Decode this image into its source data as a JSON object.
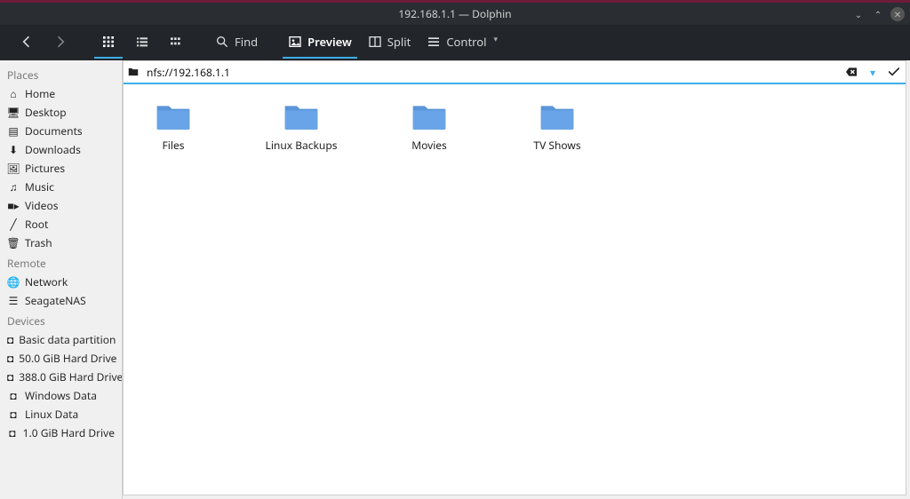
{
  "titlebar": {
    "title": "192.168.1.1 — Dolphin"
  },
  "toolbar": {
    "find": "Find",
    "preview": "Preview",
    "split": "Split",
    "control": "Control"
  },
  "addressbar": {
    "value": "nfs://192.168.1.1"
  },
  "sidebar": {
    "sections": [
      {
        "title": "Places",
        "items": [
          {
            "icon": "home",
            "label": "Home"
          },
          {
            "icon": "desktop",
            "label": "Desktop"
          },
          {
            "icon": "doc",
            "label": "Documents"
          },
          {
            "icon": "download",
            "label": "Downloads"
          },
          {
            "icon": "picture",
            "label": "Pictures"
          },
          {
            "icon": "music",
            "label": "Music"
          },
          {
            "icon": "video",
            "label": "Videos"
          },
          {
            "icon": "root",
            "label": "Root"
          },
          {
            "icon": "trash",
            "label": "Trash"
          }
        ]
      },
      {
        "title": "Remote",
        "items": [
          {
            "icon": "network",
            "label": "Network"
          },
          {
            "icon": "nas",
            "label": "SeagateNAS"
          }
        ]
      },
      {
        "title": "Devices",
        "items": [
          {
            "icon": "disk",
            "label": "Basic data partition"
          },
          {
            "icon": "disk",
            "label": "50.0 GiB Hard Drive"
          },
          {
            "icon": "disk",
            "label": "388.0 GiB Hard Drive"
          },
          {
            "icon": "disk",
            "label": "Windows Data"
          },
          {
            "icon": "disk",
            "label": "Linux Data"
          },
          {
            "icon": "disk",
            "label": "1.0 GiB Hard Drive"
          }
        ]
      }
    ]
  },
  "folders": [
    {
      "label": "Files"
    },
    {
      "label": "Linux Backups"
    },
    {
      "label": "Movies"
    },
    {
      "label": "TV Shows"
    }
  ]
}
